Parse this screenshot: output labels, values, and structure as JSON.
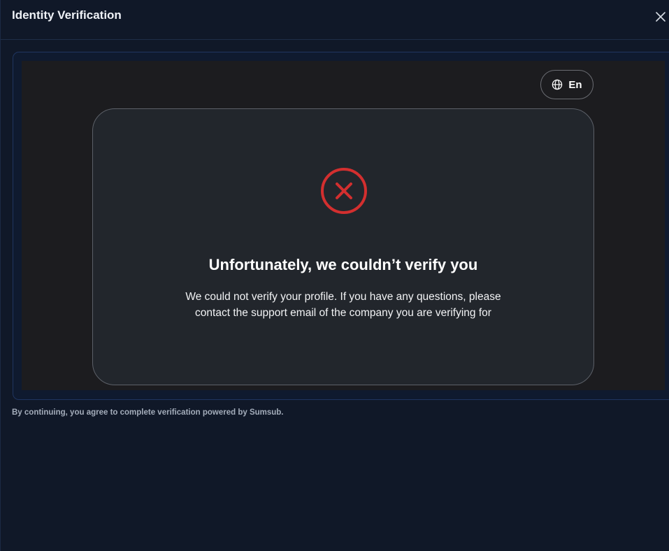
{
  "dialog": {
    "title": "Identity Verification",
    "close_icon": "close-icon"
  },
  "sdk": {
    "language": {
      "icon": "globe-icon",
      "label": "En"
    },
    "result": {
      "status_icon": "error-circle-x-icon",
      "status_color": "#d32f2f",
      "title": "Unfortunately, we couldn’t verify you",
      "message_line1": "We could not verify your profile. If you have any questions, please",
      "message_line2": "contact the support email of the company you are verifying for"
    }
  },
  "footer": {
    "text": "By continuing, you agree to complete verification powered by Sumsub."
  },
  "colors": {
    "page_background": "#101828",
    "sdk_background": "#1c1c1f",
    "card_background": "#22262c",
    "error_red": "#d32f2f"
  }
}
